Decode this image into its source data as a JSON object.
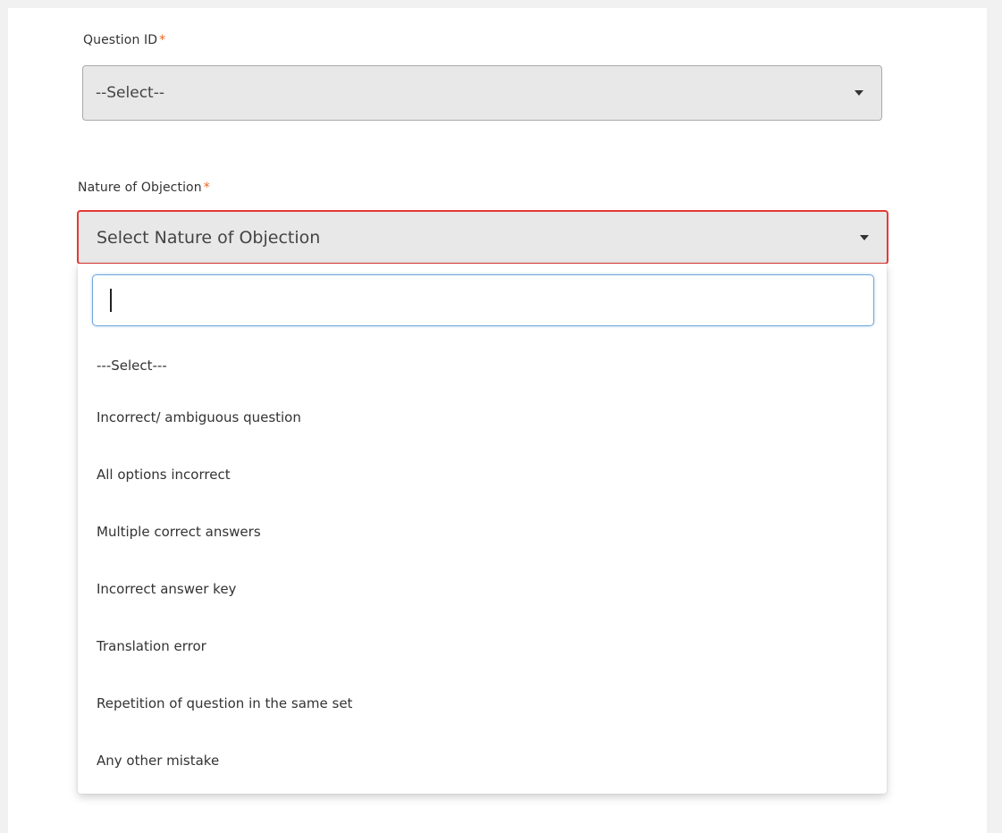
{
  "question_id": {
    "label": "Question ID",
    "required_mark": "*",
    "selected_value": "--Select--"
  },
  "nature_of_objection": {
    "label": "Nature of Objection",
    "required_mark": "*",
    "selected_value": "Select Nature of Objection",
    "error_border_color": "#e53935",
    "dropdown": {
      "search_value": "",
      "options": [
        "---Select---",
        "Incorrect/ ambiguous question",
        "All options incorrect",
        "Multiple correct answers",
        "Incorrect answer key",
        "Translation error",
        "Repetition of question in the same set",
        "Any other mistake"
      ]
    }
  },
  "colors": {
    "required_asterisk": "#e8661c",
    "focus_border": "#6ea8dc",
    "field_background": "#e8e8e8"
  },
  "icons": {
    "caret": "caret-down-icon"
  }
}
